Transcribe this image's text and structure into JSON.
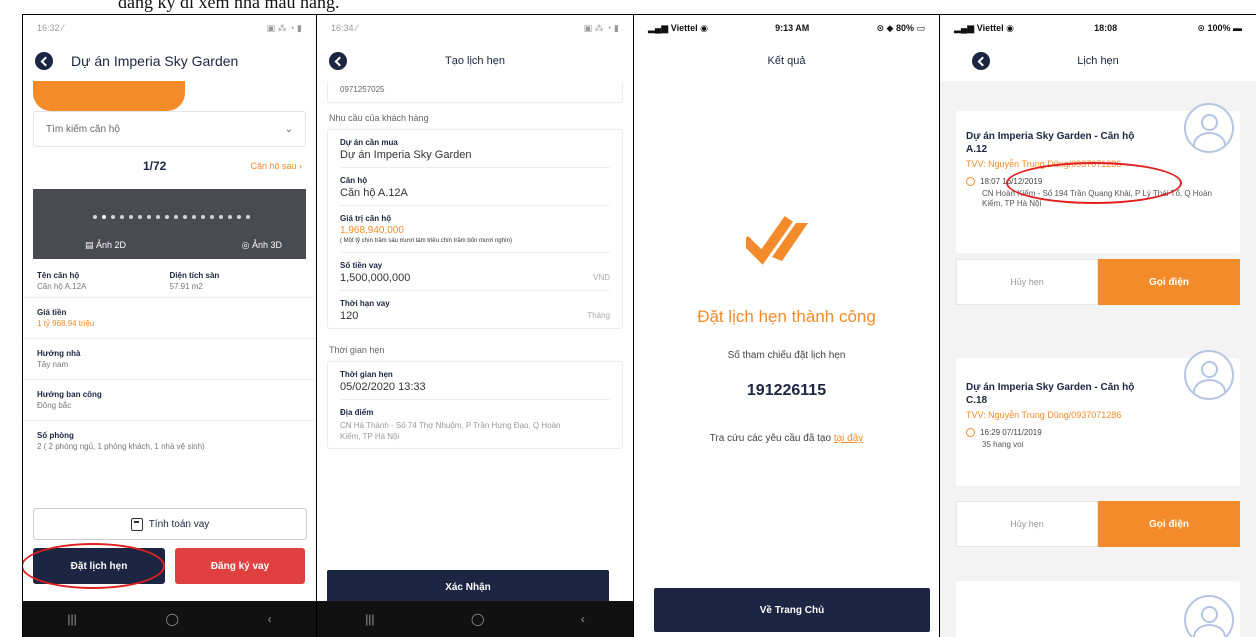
{
  "caption": "đăng ký đi xem nhà mẫu hàng.",
  "panel1": {
    "status_time": "16:32 ⁄",
    "status_icons": "▣ ⁂ ◔ ▮",
    "title": "Dự án Imperia Sky Garden",
    "search_placeholder": "Tìm kiếm căn hộ",
    "counter": "1/72",
    "next_link": "Căn hộ sau ›",
    "image_2d": "Ảnh 2D",
    "image_3d": "Ảnh 3D",
    "apartment_name_label": "Tên căn hộ",
    "apartment_name_value": "Căn hộ A.12A",
    "floor_area_label": "Diện tích sàn",
    "floor_area_value": "57.91 m2",
    "price_label": "Giá tiền",
    "price_value": "1 tỷ 968.94 triệu",
    "house_direction_label": "Hướng nhà",
    "house_direction_value": "Tây nam",
    "balcony_direction_label": "Hướng ban công",
    "balcony_direction_value": "Đông bắc",
    "rooms_label": "Số phòng",
    "rooms_value": "2 ( 2 phòng ngủ, 1 phòng khách, 1 nhà vệ sinh)",
    "loan_calc_button": "Tính toán vay",
    "book_button": "Đặt lịch hẹn",
    "register_loan_button": "Đăng ký vay"
  },
  "panel2": {
    "status_time": "16:34 ⁄",
    "status_icons": "▣ ⁂ ◔ ▮",
    "title": "Tạo lịch hẹn",
    "phone_cut": "0971257025",
    "needs_section": "Nhu cầu của khách hàng",
    "project_label": "Dự án cần mua",
    "project_value": "Dự án Imperia Sky Garden",
    "apartment_label": "Căn hộ",
    "apartment_value": "Căn hộ A.12A",
    "value_label": "Giá trị căn hộ",
    "value_amount": "1,968,940,000",
    "value_words": "( Một tỷ chín trăm sáu mươi tám triệu chín trăm bốn mươi nghìn)",
    "loan_label": "Số tiền vay",
    "loan_value": "1,500,000,000",
    "loan_unit": "VND",
    "term_label": "Thời hạn vay",
    "term_value": "120",
    "term_unit": "Tháng",
    "time_section": "Thời gian hẹn",
    "time_label": "Thời gian hẹn",
    "time_value": "05/02/2020 13:33",
    "place_label": "Địa điểm",
    "place_value": "CN Hà Thành - Số 74 Thợ Nhuộm, P Trần Hưng Đạo, Q Hoàn Kiếm, TP Hà Nội",
    "confirm_button": "Xác Nhận"
  },
  "panel3": {
    "carrier": "Viettel",
    "time": "9:13 AM",
    "battery": "80%",
    "title": "Kết quả",
    "success_text": "Đặt lịch hẹn thành công",
    "ref_label": "Số tham chiếu đặt lịch hẹn",
    "ref_number": "191226115",
    "lookup_text": "Tra cứu các yêu cầu đã tạo ",
    "lookup_link": "tại đây",
    "home_button": "Về Trang Chủ",
    "check_color": "#f48b2a"
  },
  "panel4": {
    "carrier": "Viettel",
    "time": "18:08",
    "battery": "100%",
    "title": "Lịch hẹn",
    "appointments": [
      {
        "title": "Dự án Imperia Sky Garden - Căn hộ A.12",
        "tvv": "TVV: Nguyễn Trung Dũng/0937071286",
        "datetime": "18:07 16/12/2019",
        "address": "CN Hoàn Kiếm - Số 194 Trần Quang Khải, P Lý Thái Tổ, Q Hoàn Kiếm, TP Hà Nội",
        "cancel": "Hủy hẹn",
        "call": "Gọi điện"
      },
      {
        "title": "Dự án Imperia Sky Garden - Căn hộ C.18",
        "tvv": "TVV: Nguyễn Trung Dũng/0937071286",
        "datetime": "16:29 07/11/2019",
        "address": "35 hang voi",
        "cancel": "Hủy hẹn",
        "call": "Gọi điện"
      }
    ]
  },
  "colors": {
    "accent": "#f48b2a",
    "navy": "#1c2541",
    "red": "#e04040",
    "annotation": "#e02020"
  },
  "nav": {
    "recents": "|||",
    "home": "◯",
    "back": "‹"
  }
}
